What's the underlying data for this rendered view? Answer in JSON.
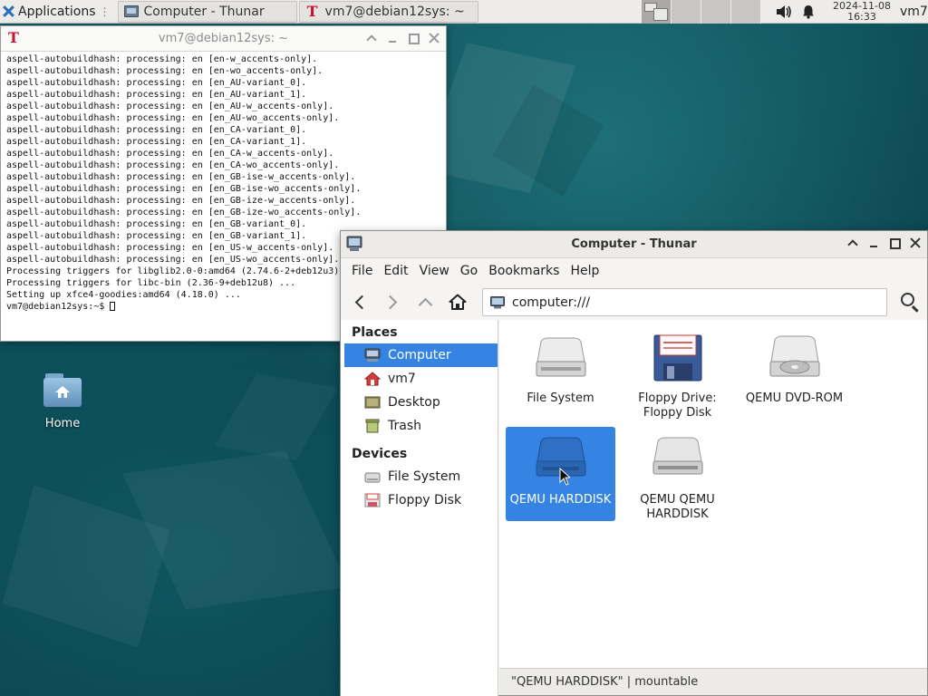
{
  "panel": {
    "applications_label": "Applications",
    "tasks": [
      {
        "label": "Computer - Thunar"
      },
      {
        "label": "vm7@debian12sys: ~"
      }
    ],
    "clock_date": "2024-11-08",
    "clock_time": "16:33",
    "user": "vm7"
  },
  "desktop": {
    "icons": [
      {
        "label": "Home",
        "icon": "home-folder-icon"
      }
    ]
  },
  "terminal": {
    "title": "vm7@debian12sys: ~",
    "lines": [
      "aspell-autobuildhash: processing: en [en-w_accents-only].",
      "aspell-autobuildhash: processing: en [en-wo_accents-only].",
      "aspell-autobuildhash: processing: en [en_AU-variant_0].",
      "aspell-autobuildhash: processing: en [en_AU-variant_1].",
      "aspell-autobuildhash: processing: en [en_AU-w_accents-only].",
      "aspell-autobuildhash: processing: en [en_AU-wo_accents-only].",
      "aspell-autobuildhash: processing: en [en_CA-variant_0].",
      "aspell-autobuildhash: processing: en [en_CA-variant_1].",
      "aspell-autobuildhash: processing: en [en_CA-w_accents-only].",
      "aspell-autobuildhash: processing: en [en_CA-wo_accents-only].",
      "aspell-autobuildhash: processing: en [en_GB-ise-w_accents-only].",
      "aspell-autobuildhash: processing: en [en_GB-ise-wo_accents-only].",
      "aspell-autobuildhash: processing: en [en_GB-ize-w_accents-only].",
      "aspell-autobuildhash: processing: en [en_GB-ize-wo_accents-only].",
      "aspell-autobuildhash: processing: en [en_GB-variant_0].",
      "aspell-autobuildhash: processing: en [en_GB-variant_1].",
      "aspell-autobuildhash: processing: en [en_US-w_accents-only].",
      "aspell-autobuildhash: processing: en [en_US-wo_accents-only].",
      "Processing triggers for libglib2.0-0:amd64 (2.74.6-2+deb12u3) ...",
      "Processing triggers for libc-bin (2.36-9+deb12u8) ...",
      "Setting up xfce4-goodies:amd64 (4.18.0) ...",
      "vm7@debian12sys:~$ "
    ]
  },
  "thunar": {
    "title": "Computer - Thunar",
    "menu": [
      "File",
      "Edit",
      "View",
      "Go",
      "Bookmarks",
      "Help"
    ],
    "location": "computer:///",
    "sidebar": {
      "places_header": "Places",
      "places": [
        {
          "label": "Computer",
          "icon": "computer-icon",
          "selected": true
        },
        {
          "label": "vm7",
          "icon": "user-home-icon"
        },
        {
          "label": "Desktop",
          "icon": "desktop-icon"
        },
        {
          "label": "Trash",
          "icon": "trash-icon"
        }
      ],
      "devices_header": "Devices",
      "devices": [
        {
          "label": "File System",
          "icon": "drive-icon"
        },
        {
          "label": "Floppy Disk",
          "icon": "floppy-icon"
        }
      ]
    },
    "items": [
      {
        "label": "File System",
        "icon": "drive-icon"
      },
      {
        "label": "Floppy Drive: Floppy Disk",
        "icon": "floppy-icon"
      },
      {
        "label": "QEMU DVD-ROM",
        "icon": "optical-drive-icon"
      },
      {
        "label": "QEMU HARDDISK",
        "icon": "harddisk-icon",
        "selected": true
      },
      {
        "label": "QEMU QEMU HARDDISK",
        "icon": "harddisk-icon"
      }
    ],
    "status": "\"QEMU HARDDISK\"  |  mountable"
  },
  "colors": {
    "selection": "#3584e4",
    "panel": "#edecea",
    "wallpaper": "#0b4a54"
  }
}
